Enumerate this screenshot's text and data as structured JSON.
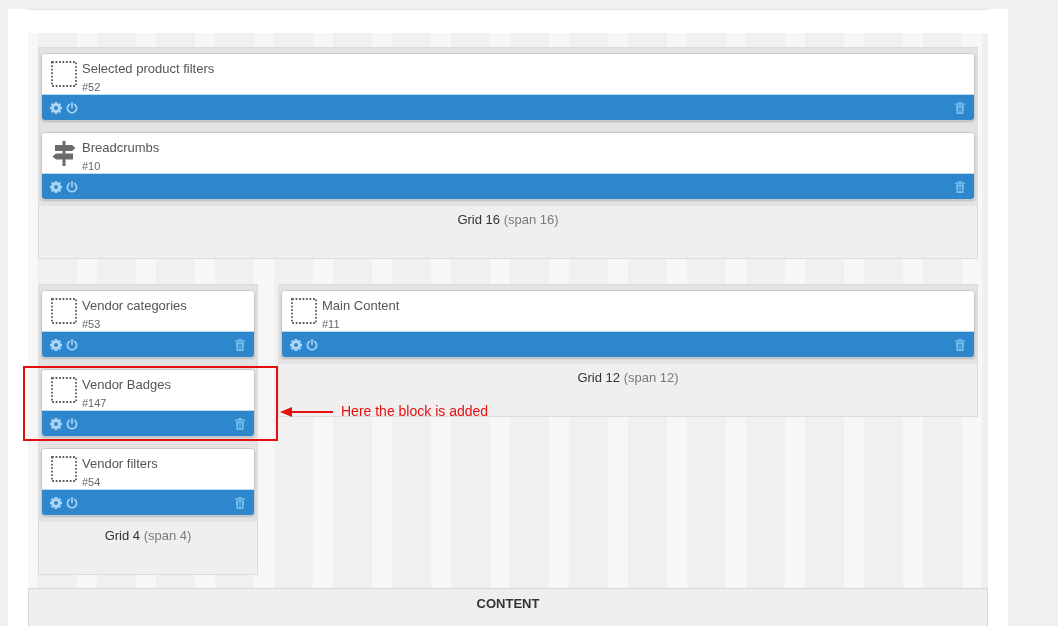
{
  "layout": {
    "rows": [
      {
        "columns": [
          {
            "name": "Grid 16",
            "span": "(span 16)",
            "blocks": [
              {
                "kind": "generic",
                "title": "Selected product filters",
                "number": "#52",
                "highlighted": false
              },
              {
                "kind": "navigation",
                "title": "Breadcrumbs",
                "number": "#10",
                "highlighted": false
              }
            ]
          }
        ]
      },
      {
        "columns": [
          {
            "name": "Grid 4",
            "span": "(span 4)",
            "blocks": [
              {
                "kind": "generic",
                "title": "Vendor categories",
                "number": "#53",
                "highlighted": false
              },
              {
                "kind": "generic",
                "title": "Vendor Badges",
                "number": "#147",
                "highlighted": true
              },
              {
                "kind": "generic",
                "title": "Vendor filters",
                "number": "#54",
                "highlighted": false
              }
            ]
          },
          {
            "name": "Grid 12",
            "span": "(span 12)",
            "blocks": [
              {
                "kind": "generic",
                "title": "Main Content",
                "number": "#11",
                "highlighted": false
              }
            ]
          }
        ]
      }
    ]
  },
  "annotation": {
    "text": "Here the block is added"
  },
  "content_section": {
    "title": "CONTENT"
  }
}
